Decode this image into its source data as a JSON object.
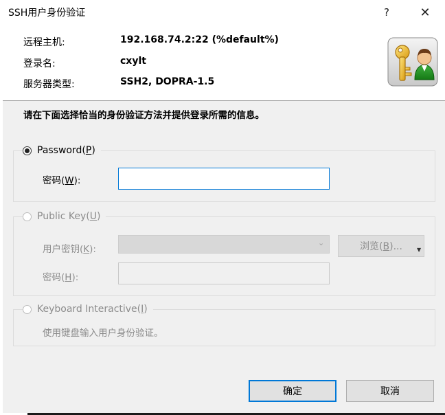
{
  "window": {
    "title": "SSH用户身份验证",
    "help_label": "?",
    "close_label": "✕"
  },
  "header": {
    "host_label": "远程主机:",
    "host_value": "192.168.74.2:22 (%default%)",
    "user_label": "登录名:",
    "user_value": "cxylt",
    "server_type_label": "服务器类型:",
    "server_type_value": "SSH2, DOPRA-1.5"
  },
  "instruction": "请在下面选择恰当的身份验证方法并提供登录所需的信息。",
  "password_method": {
    "label_prefix": "Password(",
    "label_key": "P",
    "label_suffix": ")",
    "selected": true,
    "field_label_prefix": "密码(",
    "field_label_key": "W",
    "field_label_suffix": "):",
    "field_value": ""
  },
  "publickey_method": {
    "label_prefix": "Public Key(",
    "label_key": "U",
    "label_suffix": ")",
    "selected": false,
    "key_label_prefix": "用户密钥(",
    "key_label_key": "K",
    "key_label_suffix": "):",
    "key_value": "",
    "browse_prefix": "浏览(",
    "browse_key": "B",
    "browse_suffix": ")...",
    "pass_label_prefix": "密码(",
    "pass_label_key": "H",
    "pass_label_suffix": "):",
    "pass_value": ""
  },
  "keyboard_method": {
    "label_prefix": "Keyboard Interactive(",
    "label_key": "I",
    "label_suffix": ")",
    "selected": false,
    "description": "使用键盘输入用户身份验证。"
  },
  "buttons": {
    "ok_label": "确定",
    "cancel_label": "取消"
  }
}
